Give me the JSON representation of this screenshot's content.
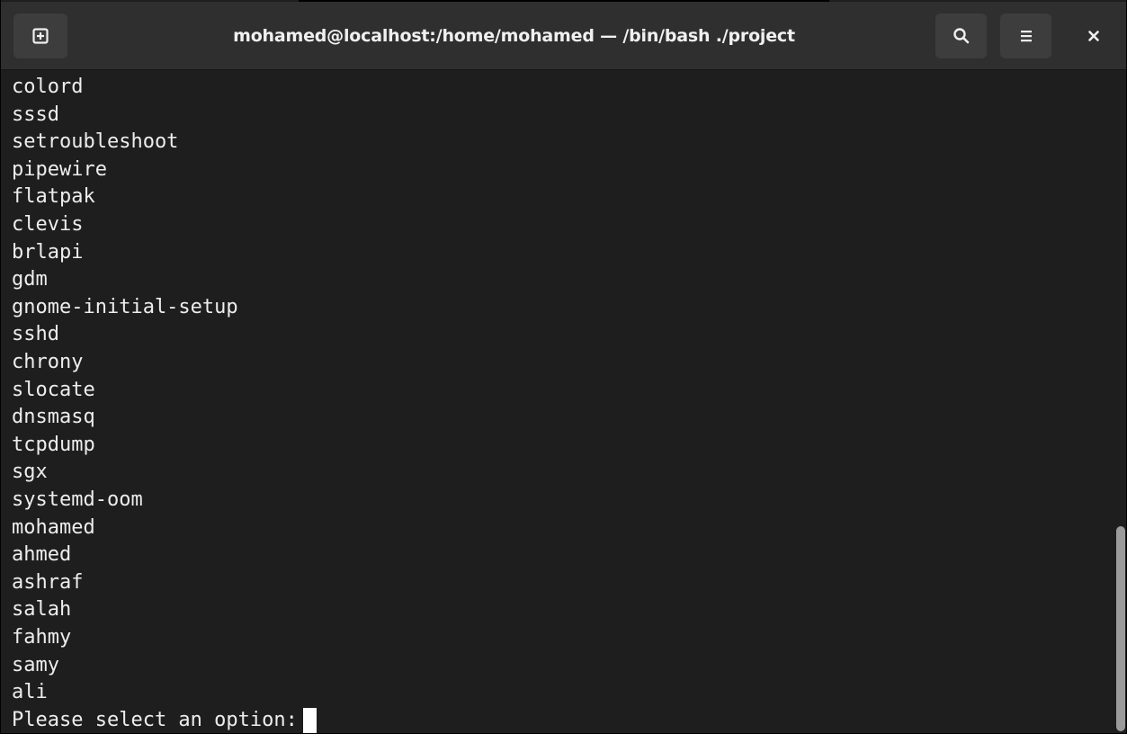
{
  "window": {
    "title": "mohamed@localhost:/home/mohamed — /bin/bash ./project"
  },
  "icons": {
    "new_tab": "new-tab-icon",
    "search": "search-icon",
    "menu": "hamburger-menu-icon",
    "close": "close-icon"
  },
  "terminal": {
    "lines": [
      "colord",
      "sssd",
      "setroubleshoot",
      "pipewire",
      "flatpak",
      "clevis",
      "brlapi",
      "gdm",
      "gnome-initial-setup",
      "sshd",
      "chrony",
      "slocate",
      "dnsmasq",
      "tcpdump",
      "sgx",
      "systemd-oom",
      "mohamed",
      "ahmed",
      "ashraf",
      "salah",
      "fahmy",
      "samy",
      "ali"
    ],
    "prompt": "Please select an option:"
  },
  "colors": {
    "titlebar": "#2f2f2f",
    "button": "#3d3d3d",
    "terminal_bg": "#1e1e1e",
    "text": "#ededed",
    "scrollbar_thumb": "#9b9b9b"
  }
}
